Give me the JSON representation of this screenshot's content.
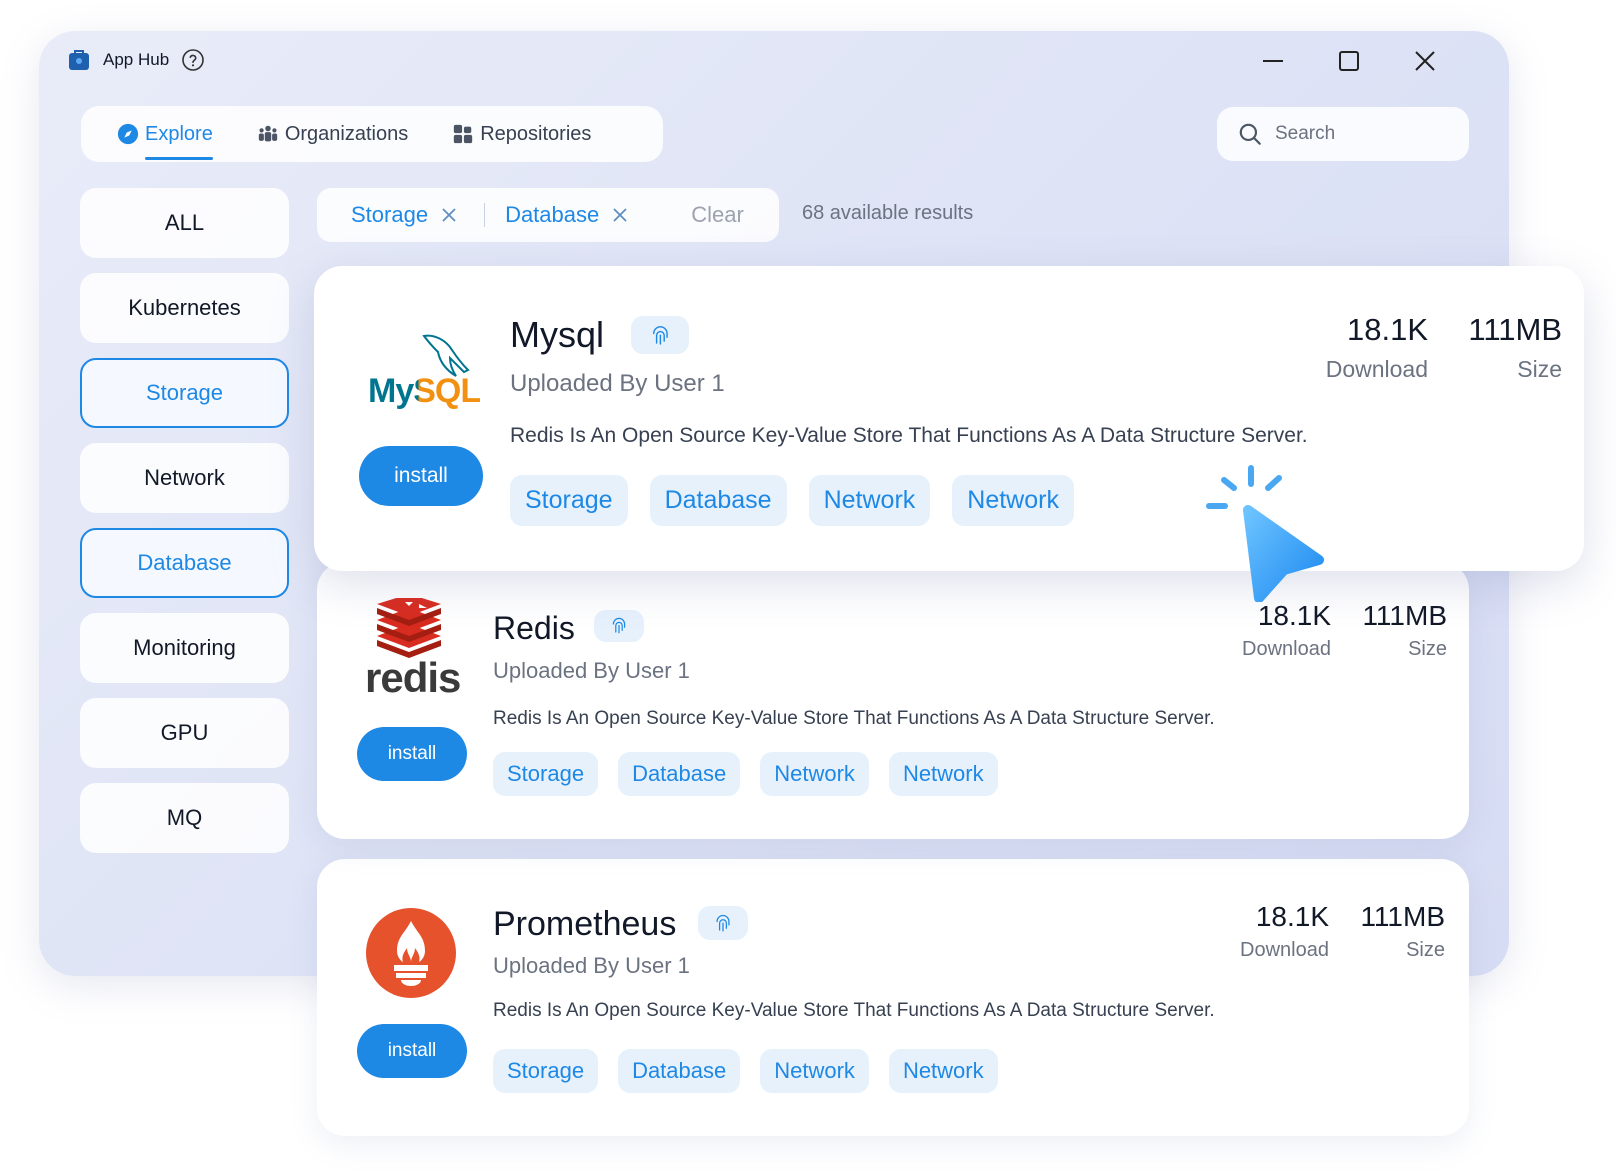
{
  "window": {
    "title": "App Hub"
  },
  "nav": {
    "tabs": [
      {
        "label": "Explore",
        "icon": "compass-icon",
        "active": true
      },
      {
        "label": "Organizations",
        "icon": "team-icon",
        "active": false
      },
      {
        "label": "Repositories",
        "icon": "blocks-icon",
        "active": false
      }
    ]
  },
  "search": {
    "placeholder": "Search",
    "value": ""
  },
  "sidebar": {
    "items": [
      {
        "label": "ALL",
        "selected": false
      },
      {
        "label": "Kubernetes",
        "selected": false
      },
      {
        "label": "Storage",
        "selected": true
      },
      {
        "label": "Network",
        "selected": false
      },
      {
        "label": "Database",
        "selected": true
      },
      {
        "label": "Monitoring",
        "selected": false
      },
      {
        "label": "GPU",
        "selected": false
      },
      {
        "label": "MQ",
        "selected": false
      }
    ]
  },
  "filters": {
    "chips": [
      "Storage",
      "Database"
    ],
    "clear_label": "Clear",
    "results_text": "68 available results"
  },
  "apps": [
    {
      "name": "Mysql",
      "uploader": "Uploaded By User 1",
      "description": "Redis Is An Open Source Key-Value Store That Functions As A Data Structure Server.",
      "install_label": "install",
      "downloads": "18.1K",
      "downloads_label": "Download",
      "size": "111MB",
      "size_label": "Size",
      "tags": [
        "Storage",
        "Database",
        "Network",
        "Network"
      ],
      "logo_text": "MySQL"
    },
    {
      "name": "Redis",
      "uploader": "Uploaded By User 1",
      "description": "Redis Is An Open Source Key-Value Store That Functions As A Data Structure Server.",
      "install_label": "install",
      "downloads": "18.1K",
      "downloads_label": "Download",
      "size": "111MB",
      "size_label": "Size",
      "tags": [
        "Storage",
        "Database",
        "Network",
        "Network"
      ],
      "logo_text": "redis"
    },
    {
      "name": "Prometheus",
      "uploader": "Uploaded By User 1",
      "description": "Redis Is An Open Source Key-Value Store That Functions As A Data Structure Server.",
      "install_label": "install",
      "downloads": "18.1K",
      "downloads_label": "Download",
      "size": "111MB",
      "size_label": "Size",
      "tags": [
        "Storage",
        "Database",
        "Network",
        "Network"
      ]
    }
  ],
  "colors": {
    "accent": "#1e88e5",
    "tag_bg": "#e6f1fc",
    "prometheus": "#e6522c",
    "redis": "#d82c20",
    "mysql_blue": "#00758f",
    "mysql_orange": "#f29111"
  }
}
